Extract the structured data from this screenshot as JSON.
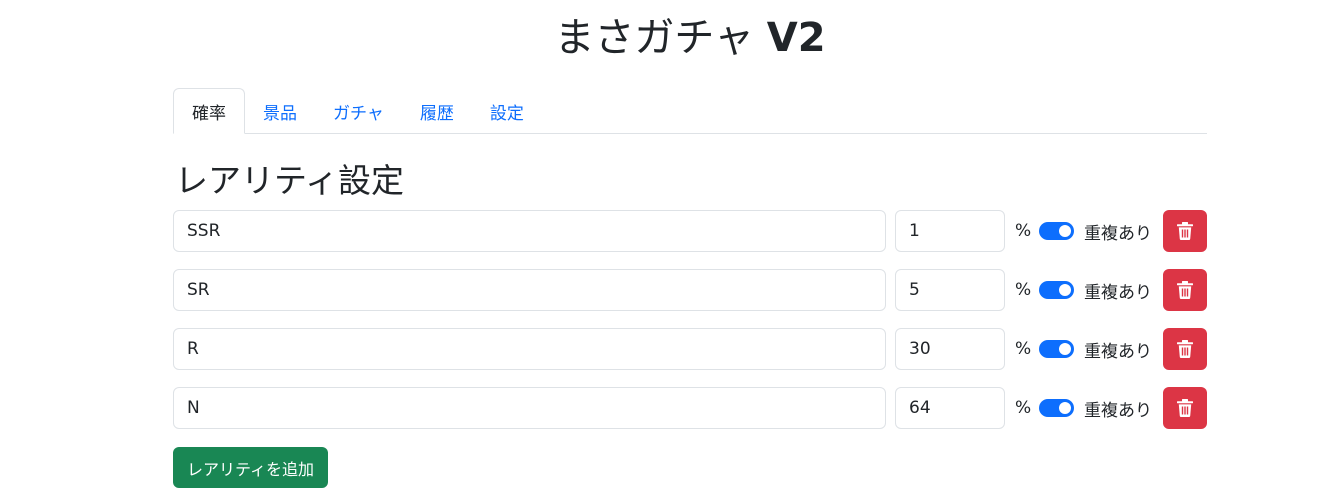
{
  "header": {
    "title_main": "まさガチャ ",
    "title_version": "V2"
  },
  "tabs": [
    {
      "label": "確率",
      "active": true
    },
    {
      "label": "景品",
      "active": false
    },
    {
      "label": "ガチャ",
      "active": false
    },
    {
      "label": "履歴",
      "active": false
    },
    {
      "label": "設定",
      "active": false
    }
  ],
  "section": {
    "title": "レアリティ設定"
  },
  "rarities": [
    {
      "name": "SSR",
      "rate": "1",
      "unit": "%",
      "duplicate_enabled": true,
      "duplicate_label": "重複あり"
    },
    {
      "name": "SR",
      "rate": "5",
      "unit": "%",
      "duplicate_enabled": true,
      "duplicate_label": "重複あり"
    },
    {
      "name": "R",
      "rate": "30",
      "unit": "%",
      "duplicate_enabled": true,
      "duplicate_label": "重複あり"
    },
    {
      "name": "N",
      "rate": "64",
      "unit": "%",
      "duplicate_enabled": true,
      "duplicate_label": "重複あり"
    }
  ],
  "actions": {
    "add_label": "レアリティを追加"
  },
  "colors": {
    "primary": "#0d6efd",
    "danger": "#dc3545",
    "success": "#198754",
    "border": "#dee2e6",
    "text": "#212529"
  },
  "icons": {
    "delete": "trash-icon"
  }
}
